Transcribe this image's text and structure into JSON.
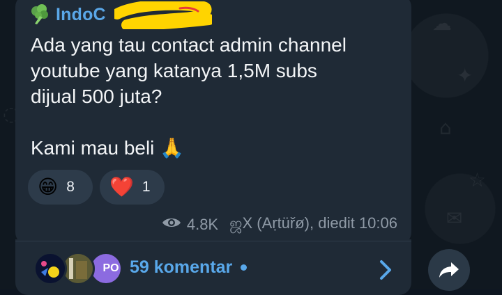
{
  "sender": {
    "name": "IndoC",
    "icon": "broccoli-icon"
  },
  "message": {
    "text": "Ada yang tau contact admin channel\nyoutube yang katanya 1,5M subs\ndijual 500 juta?\n\nKami mau beli 🙏"
  },
  "reactions": [
    {
      "emoji": "😁",
      "count": "8"
    },
    {
      "emoji": "❤️",
      "count": "1"
    }
  ],
  "meta": {
    "views": "4.8K",
    "author": "ஜX (Aṛtüřø), diedit 10:06",
    "eye_icon": "eye-icon"
  },
  "footer": {
    "comments_label": "59 komentar",
    "avatar_partial_text": "PO",
    "chevron_icon": "chevron-right-icon",
    "share_icon": "share-icon"
  },
  "colors": {
    "bubble": "#1f2a36",
    "accent": "#59a8ea",
    "text": "#f3f5f7",
    "muted": "#8f9aa6"
  }
}
